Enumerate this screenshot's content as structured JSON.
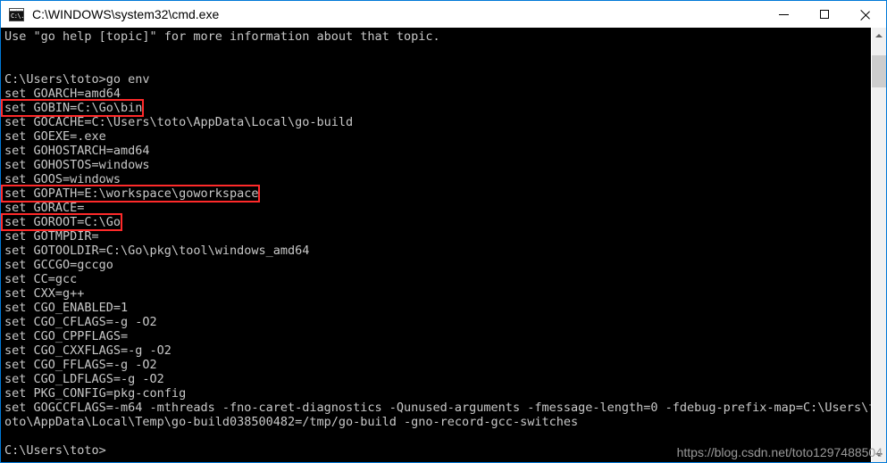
{
  "window": {
    "title": "C:\\WINDOWS\\system32\\cmd.exe",
    "icon": "cmd-icon",
    "accent_color": "#0078d7",
    "controls": {
      "minimize_label": "Minimize",
      "maximize_label": "Maximize",
      "close_label": "Close"
    }
  },
  "console": {
    "background_color": "#000000",
    "foreground_color": "#c8c8c8",
    "highlight_color": "#ff2a2a",
    "lines": [
      {
        "text": "Use \"go help [topic]\" for more information about that topic.",
        "highlighted": false
      },
      {
        "text": "",
        "highlighted": false
      },
      {
        "text": "",
        "highlighted": false
      },
      {
        "text": "C:\\Users\\toto>go env",
        "highlighted": false
      },
      {
        "text": "set GOARCH=amd64",
        "highlighted": false
      },
      {
        "text": "set GOBIN=C:\\Go\\bin",
        "highlighted": true
      },
      {
        "text": "set GOCACHE=C:\\Users\\toto\\AppData\\Local\\go-build",
        "highlighted": false
      },
      {
        "text": "set GOEXE=.exe",
        "highlighted": false
      },
      {
        "text": "set GOHOSTARCH=amd64",
        "highlighted": false
      },
      {
        "text": "set GOHOSTOS=windows",
        "highlighted": false
      },
      {
        "text": "set GOOS=windows",
        "highlighted": false
      },
      {
        "text": "set GOPATH=E:\\workspace\\goworkspace",
        "highlighted": true
      },
      {
        "text": "set GORACE=",
        "highlighted": false
      },
      {
        "text": "set GOROOT=C:\\Go",
        "highlighted": true
      },
      {
        "text": "set GOTMPDIR=",
        "highlighted": false
      },
      {
        "text": "set GOTOOLDIR=C:\\Go\\pkg\\tool\\windows_amd64",
        "highlighted": false
      },
      {
        "text": "set GCCGO=gccgo",
        "highlighted": false
      },
      {
        "text": "set CC=gcc",
        "highlighted": false
      },
      {
        "text": "set CXX=g++",
        "highlighted": false
      },
      {
        "text": "set CGO_ENABLED=1",
        "highlighted": false
      },
      {
        "text": "set CGO_CFLAGS=-g -O2",
        "highlighted": false
      },
      {
        "text": "set CGO_CPPFLAGS=",
        "highlighted": false
      },
      {
        "text": "set CGO_CXXFLAGS=-g -O2",
        "highlighted": false
      },
      {
        "text": "set CGO_FFLAGS=-g -O2",
        "highlighted": false
      },
      {
        "text": "set CGO_LDFLAGS=-g -O2",
        "highlighted": false
      },
      {
        "text": "set PKG_CONFIG=pkg-config",
        "highlighted": false
      },
      {
        "text": "set GOGCCFLAGS=-m64 -mthreads -fno-caret-diagnostics -Qunused-arguments -fmessage-length=0 -fdebug-prefix-map=C:\\Users\\t",
        "highlighted": false
      },
      {
        "text": "oto\\AppData\\Local\\Temp\\go-build038500482=/tmp/go-build -gno-record-gcc-switches",
        "highlighted": false
      },
      {
        "text": "",
        "highlighted": false
      },
      {
        "text": "C:\\Users\\toto>",
        "highlighted": false
      }
    ]
  },
  "watermark": {
    "text": "https://blog.csdn.net/toto1297488504",
    "color": "#9a9a9a"
  },
  "scrollbar": {
    "up_arrow": "chevron-up-icon",
    "down_arrow": "chevron-down-icon",
    "thumb_position_percent": 3,
    "thumb_size_percent": 8
  }
}
